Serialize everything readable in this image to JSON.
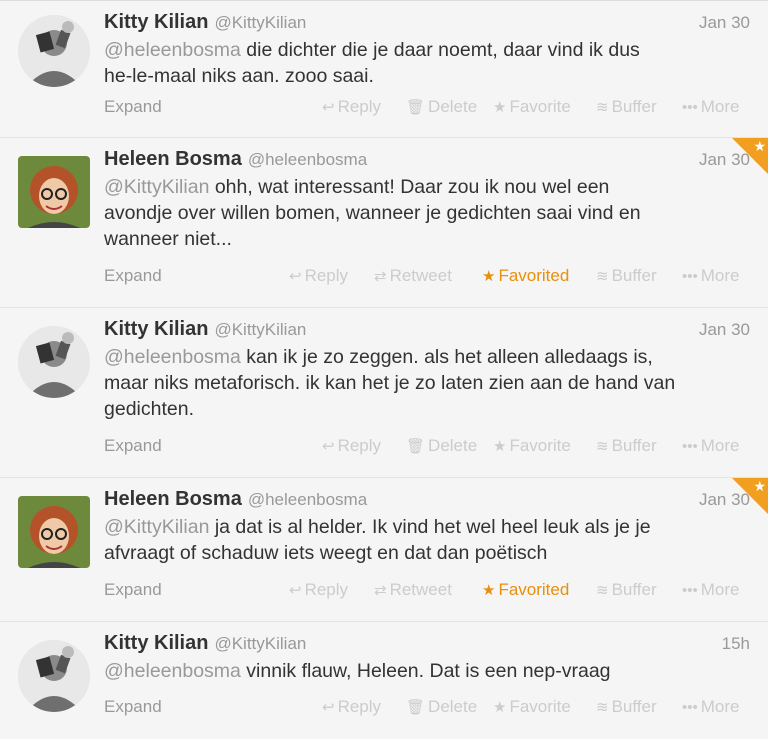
{
  "tweets": [
    {
      "name": "Kitty Kilian",
      "handle": "@KittyKilian",
      "time": "Jan 30",
      "mention": "@heleenbosma",
      "line1": " die dichter die je daar noemt, daar vind ik dus",
      "lines": [
        "he-le-maal niks aan. zooo saai."
      ],
      "expand": "Expand",
      "actions": [
        "Reply",
        "Delete",
        "Favorite",
        "Buffer",
        "More"
      ]
    },
    {
      "name": "Heleen Bosma",
      "handle": "@heleenbosma",
      "time": "Jan 30",
      "mention": "@KittyKilian",
      "line1": " ohh, wat interessant! Daar zou ik nou wel een",
      "lines": [
        "avondje over willen bomen, wanneer je gedichten saai vind en",
        "wanneer niet..."
      ],
      "expand": "Expand",
      "actions": [
        "Reply",
        "Retweet",
        "Favorited",
        "Buffer",
        "More"
      ]
    },
    {
      "name": "Kitty Kilian",
      "handle": "@KittyKilian",
      "time": "Jan 30",
      "mention": "@heleenbosma",
      "line1": " kan ik je zo zeggen. als het alleen alledaags is,",
      "lines": [
        "maar niks metaforisch. ik kan het je zo laten zien aan de hand van",
        "gedichten."
      ],
      "expand": "Expand",
      "actions": [
        "Reply",
        "Delete",
        "Favorite",
        "Buffer",
        "More"
      ]
    },
    {
      "name": "Heleen Bosma",
      "handle": "@heleenbosma",
      "time": "Jan 30",
      "mention": "@KittyKilian",
      "line1": " ja dat is al helder. Ik vind het wel heel leuk als je je",
      "lines": [
        "afvraagt of schaduw iets weegt en dat dan poëtisch"
      ],
      "expand": "Expand",
      "actions": [
        "Reply",
        "Retweet",
        "Favorited",
        "Buffer",
        "More"
      ]
    },
    {
      "name": "Kitty Kilian",
      "handle": "@KittyKilian",
      "time": "15h",
      "mention": "@heleenbosma",
      "line1": " vinnik flauw, Heleen. Dat is een nep-vraag",
      "lines": [],
      "expand": "Expand",
      "actions": [
        "Reply",
        "Delete",
        "Favorite",
        "Buffer",
        "More"
      ]
    }
  ],
  "icons": {
    "reply": "reply-icon",
    "delete": "trash-icon",
    "retweet": "retweet-icon",
    "favorite": "star-icon",
    "buffer": "buffer-icon",
    "more": "more-icon",
    "corner": "favorited-corner-star-icon"
  },
  "colors": {
    "favorited": "#e88f0c",
    "corner": "#f29e1f",
    "muted": "#999999",
    "actions_disabled": "#cccccc"
  }
}
